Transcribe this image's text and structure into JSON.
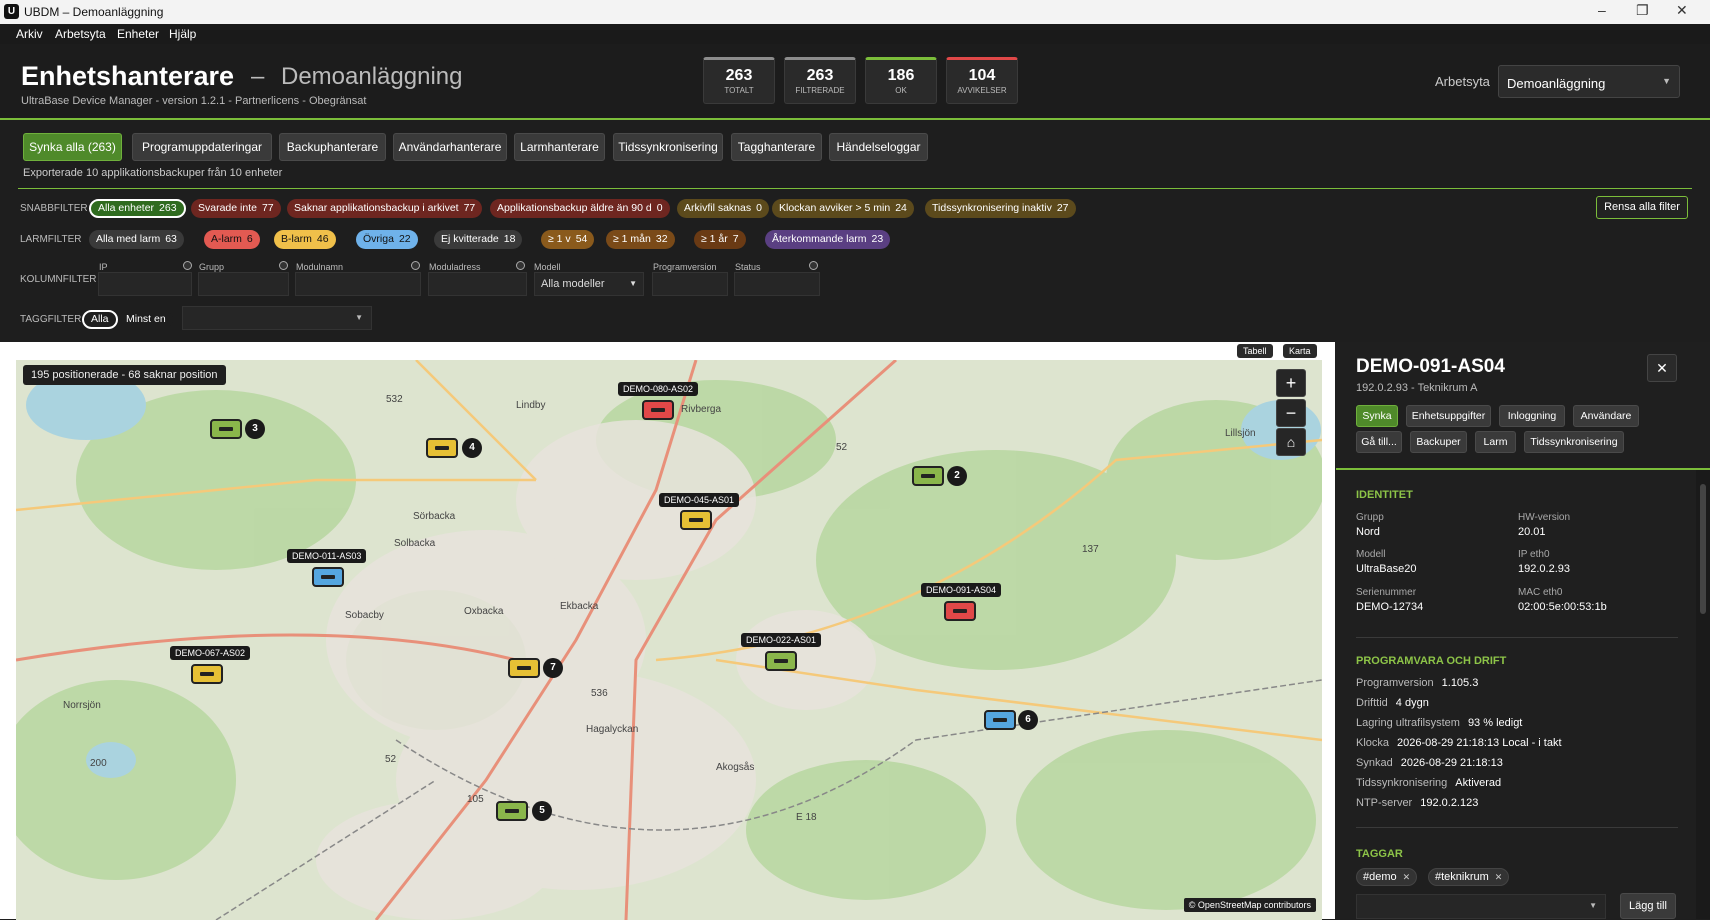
{
  "window": {
    "title": "UBDM – Demoanläggning",
    "logo": "U"
  },
  "menu": [
    "Arkiv",
    "Arbetsyta",
    "Enheter",
    "Hjälp"
  ],
  "header": {
    "title": "Enhetshanterare",
    "dash": "–",
    "subtitle": "Demoanläggning",
    "version": "UltraBase Device Manager - version 1.2.1 - Partnerlicens - Obegränsat"
  },
  "stats": [
    {
      "value": "263",
      "label": "TOTALT",
      "color": "#8c8c8c"
    },
    {
      "value": "263",
      "label": "FILTRERADE",
      "color": "#8c8c8c"
    },
    {
      "value": "186",
      "label": "OK",
      "color": "#7bbd3a"
    },
    {
      "value": "104",
      "label": "AVVIKELSER",
      "color": "#e04848"
    }
  ],
  "workspace": {
    "label": "Arbetsyta",
    "value": "Demoanläggning"
  },
  "toolbar": [
    "Synka alla (263)",
    "Programuppdateringar",
    "Backuphanterare",
    "Användarhanterare",
    "Larmhanterare",
    "Tidssynkronisering",
    "Tagghanterare",
    "Händelseloggar"
  ],
  "export_msg": "Exporterade 10 applikationsbackuper från 10 enheter",
  "quick_filters": {
    "label": "SNABBFILTER",
    "chips": [
      {
        "text": "Alla enheter",
        "count": "263",
        "bg": "#2f6b1f",
        "border": "#ffffff"
      },
      {
        "text": "Svarade inte",
        "count": "77",
        "bg": "#6e2620"
      },
      {
        "text": "Saknar applikationsbackup i arkivet",
        "count": "77",
        "bg": "#6e2620"
      },
      {
        "text": "Applikationsbackup äldre än 90 d",
        "count": "0",
        "bg": "#6e2620"
      },
      {
        "text": "Arkivfil saknas",
        "count": "0",
        "bg": "#5c4a1c"
      },
      {
        "text": "Klockan avviker > 5 min",
        "count": "24",
        "bg": "#5c4a1c"
      },
      {
        "text": "Tidssynkronisering inaktiv",
        "count": "27",
        "bg": "#5c4a1c"
      }
    ],
    "clear": "Rensa alla filter"
  },
  "alarm_filters": {
    "label": "LARMFILTER",
    "chips": [
      {
        "text": "Alla med larm",
        "count": "63",
        "bg": "#3a3a3a",
        "fg": "#ffffff"
      },
      {
        "text": "A-larm",
        "count": "6",
        "bg": "#e35a52",
        "fg": "#111111"
      },
      {
        "text": "B-larm",
        "count": "46",
        "bg": "#f0c04a",
        "fg": "#111111"
      },
      {
        "text": "Övriga",
        "count": "22",
        "bg": "#6fb2ea",
        "fg": "#111111"
      },
      {
        "text": "Ej kvitterade",
        "count": "18",
        "bg": "#3a3a3a",
        "fg": "#ffffff"
      },
      {
        "text": "≥ 1 v",
        "count": "54",
        "bg": "#8a5a1c",
        "fg": "#ffffff"
      },
      {
        "text": "≥ 1 mån",
        "count": "32",
        "bg": "#7a4a18",
        "fg": "#ffffff"
      },
      {
        "text": "≥ 1 år",
        "count": "7",
        "bg": "#6a3a14",
        "fg": "#ffffff"
      },
      {
        "text": "Återkommande larm",
        "count": "23",
        "bg": "#5a3f82",
        "fg": "#ffffff"
      }
    ]
  },
  "column_filters": {
    "label": "KOLUMNFILTER",
    "fields": [
      "IP",
      "Grupp",
      "Modulnamn",
      "Moduladress",
      "Modell",
      "Programversion",
      "Status"
    ],
    "model_value": "Alla modeller"
  },
  "tag_filter": {
    "label": "TAGGFILTER",
    "all": "Alla",
    "atleast": "Minst en"
  },
  "map": {
    "views": [
      "Tabell",
      "Karta"
    ],
    "badge": "195 positionerade - 68 saknar position",
    "attribution": "© OpenStreetMap contributors",
    "places": [
      "Lindby",
      "Rivberga",
      "Sörbacka",
      "Solbacka",
      "Sobacby",
      "Oxbacka",
      "Ekbacka",
      "Hagalyckan",
      "Akogsås",
      "Norrsjön",
      "Lillsjön",
      "532",
      "52",
      "536",
      "137",
      "200",
      "52",
      "E 18",
      "105"
    ],
    "markers": [
      {
        "label": "DEMO-080-AS02",
        "color": "r"
      },
      {
        "label": "DEMO-045-AS01",
        "color": "y"
      },
      {
        "label": "DEMO-011-AS03",
        "color": "b"
      },
      {
        "label": "DEMO-091-AS04",
        "color": "r"
      },
      {
        "label": "DEMO-022-AS01",
        "color": "g"
      },
      {
        "label": "DEMO-067-AS02",
        "color": "y"
      }
    ],
    "clusters": [
      {
        "count": "3",
        "color": "g"
      },
      {
        "count": "4",
        "color": "y"
      },
      {
        "count": "2",
        "color": "g"
      },
      {
        "count": "7",
        "color": "y"
      },
      {
        "count": "6",
        "color": "b"
      },
      {
        "count": "5",
        "color": "g"
      }
    ]
  },
  "detail": {
    "title": "DEMO-091-AS04",
    "sub": "192.0.2.93 - Teknikrum A",
    "buttons": [
      "Synka",
      "Enhetsuppgifter",
      "Inloggning",
      "Användare",
      "Gå till...",
      "Backuper",
      "Larm",
      "Tidssynkronisering"
    ],
    "identity": {
      "heading": "IDENTITET",
      "fields": [
        {
          "k": "Grupp",
          "v": "Nord"
        },
        {
          "k": "HW-version",
          "v": "20.01"
        },
        {
          "k": "Modell",
          "v": "UltraBase20"
        },
        {
          "k": "IP eth0",
          "v": "192.0.2.93"
        },
        {
          "k": "Serienummer",
          "v": "DEMO-12734"
        },
        {
          "k": "MAC eth0",
          "v": "02:00:5e:00:53:1b"
        }
      ]
    },
    "software": {
      "heading": "PROGRAMVARA OCH DRIFT",
      "rows": [
        {
          "k": "Programversion",
          "v": "1.105.3"
        },
        {
          "k": "Drifttid",
          "v": "4 dygn"
        },
        {
          "k": "Lagring ultrafilsystem",
          "v": "93 % ledigt"
        },
        {
          "k": "Klocka",
          "v": "2026-08-29 21:18:13 Local - i takt"
        },
        {
          "k": "Synkad",
          "v": "2026-08-29 21:18:13"
        },
        {
          "k": "Tidssynkronisering",
          "v": "Aktiverad"
        },
        {
          "k": "NTP-server",
          "v": "192.0.2.123"
        }
      ]
    },
    "tags": {
      "heading": "TAGGAR",
      "items": [
        "#demo",
        "#teknikrum"
      ],
      "add": "Lägg till"
    }
  }
}
